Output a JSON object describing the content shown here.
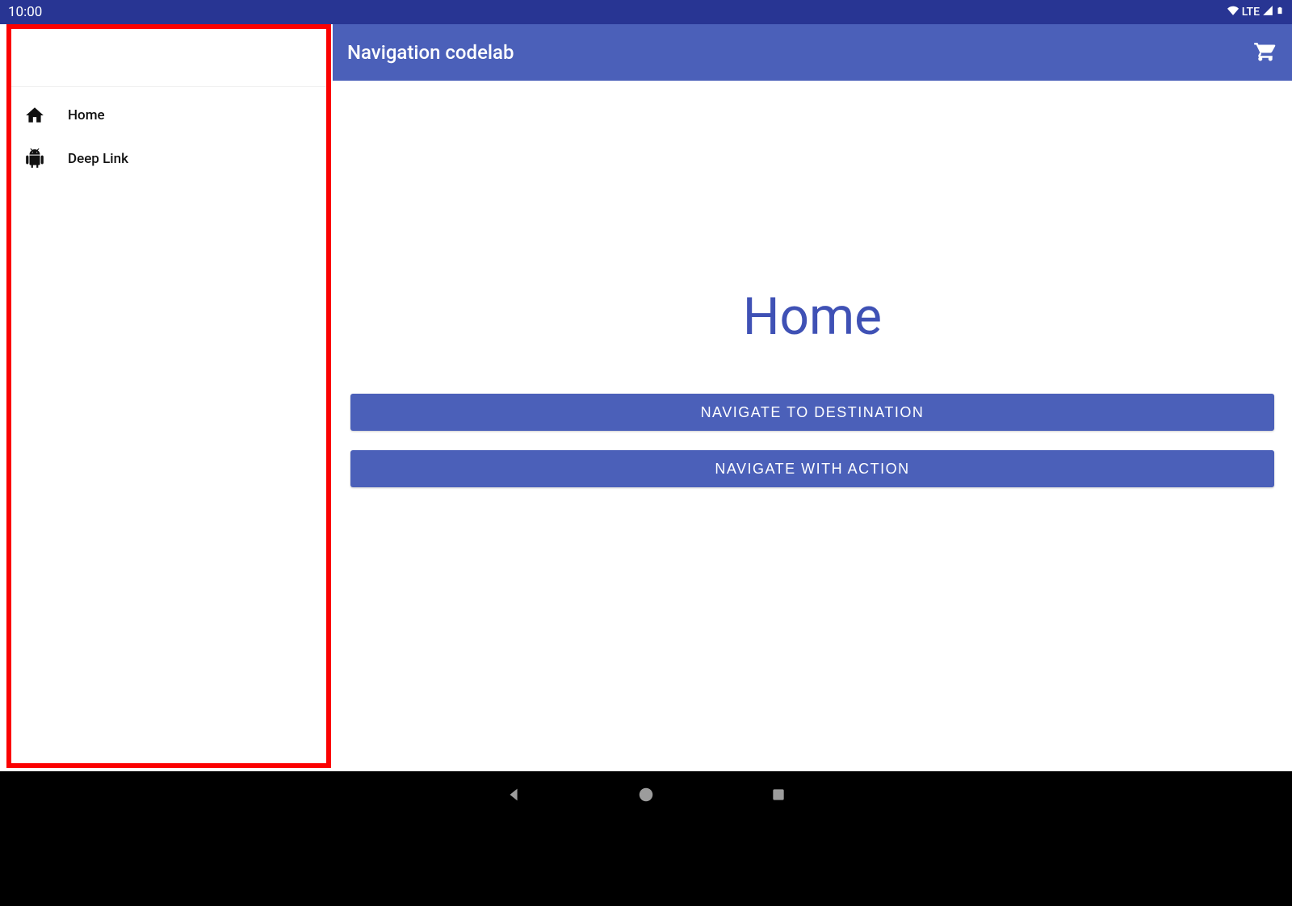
{
  "statusbar": {
    "clock": "10:00",
    "network_label": "LTE"
  },
  "appbar": {
    "title": "Navigation codelab",
    "action_icon": "shopping-cart-icon"
  },
  "drawer": {
    "items": [
      {
        "icon": "home-icon",
        "label": "Home"
      },
      {
        "icon": "android-icon",
        "label": "Deep Link"
      }
    ]
  },
  "content": {
    "headline": "Home",
    "buttons": [
      "NAVIGATE TO DESTINATION",
      "NAVIGATE WITH ACTION"
    ]
  },
  "colors": {
    "primary": "#4b60b9",
    "primary_dark": "#283593",
    "accent_text": "#3f51b5",
    "highlight_border": "#fb0101"
  }
}
